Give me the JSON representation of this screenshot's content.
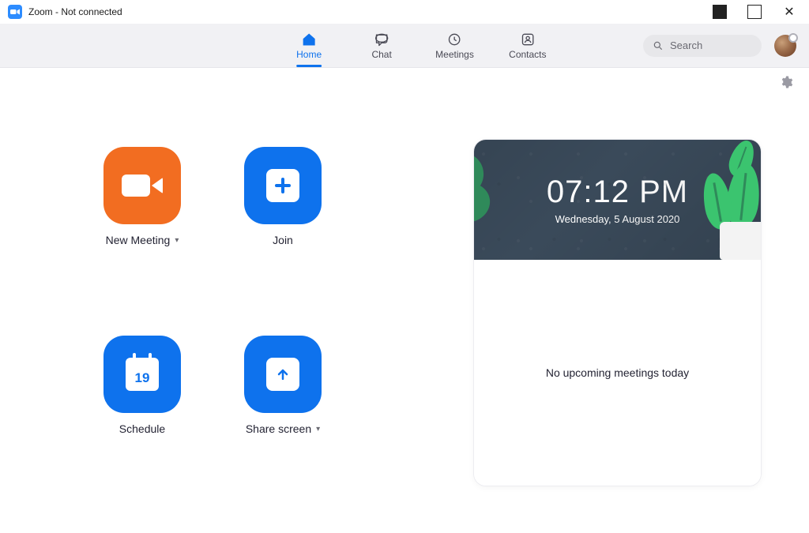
{
  "window": {
    "title": "Zoom - Not connected"
  },
  "nav": {
    "tabs": [
      {
        "label": "Home",
        "active": true
      },
      {
        "label": "Chat",
        "active": false
      },
      {
        "label": "Meetings",
        "active": false
      },
      {
        "label": "Contacts",
        "active": false
      }
    ],
    "search_placeholder": "Search"
  },
  "actions": {
    "new_meeting": {
      "label": "New Meeting",
      "has_dropdown": true
    },
    "join": {
      "label": "Join",
      "has_dropdown": false
    },
    "schedule": {
      "label": "Schedule",
      "calendar_day": "19",
      "has_dropdown": false
    },
    "share_screen": {
      "label": "Share screen",
      "has_dropdown": true
    }
  },
  "dashboard": {
    "time": "07:12 PM",
    "date": "Wednesday, 5 August 2020",
    "empty_message": "No upcoming meetings today"
  },
  "colors": {
    "accent_blue": "#0e72ed",
    "accent_orange": "#f26d21"
  }
}
